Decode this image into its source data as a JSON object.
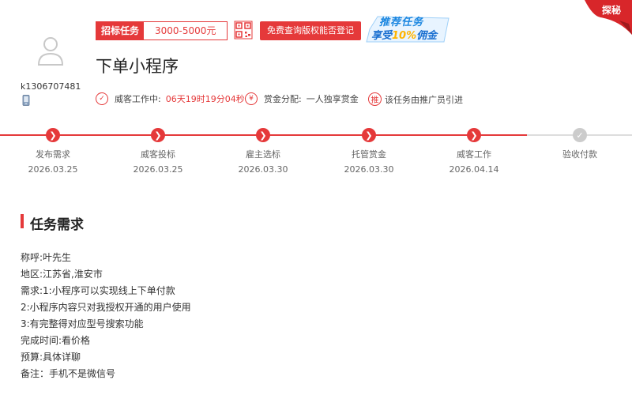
{
  "user": {
    "name": "k1306707481"
  },
  "banner": {
    "bid_tag": "招标任务",
    "bid_price": "3000-5000元",
    "check_button": "免费查询版权能否登记",
    "promo_line1": "推荐任务",
    "promo_line2_pre": "享受",
    "promo_line2_em": "10%",
    "promo_line2_post": "佣金",
    "corner_badge": "探秘"
  },
  "task": {
    "title": "下单小程序"
  },
  "meta": {
    "working_label": "威客工作中:",
    "working_time": "06天19时19分04秒",
    "reward_label": "赏金分配:",
    "reward_value": "一人独享赏金",
    "referral_badge": "推",
    "referral_text": "该任务由推广员引进"
  },
  "steps": [
    {
      "label": "发布需求",
      "date": "2026.03.25",
      "done": true
    },
    {
      "label": "威客投标",
      "date": "2026.03.25",
      "done": true
    },
    {
      "label": "雇主选标",
      "date": "2026.03.30",
      "done": true
    },
    {
      "label": "托管赏金",
      "date": "2026.03.30",
      "done": true
    },
    {
      "label": "威客工作",
      "date": "2026.04.14",
      "done": true
    },
    {
      "label": "验收付款",
      "date": "",
      "done": false
    }
  ],
  "requirements": {
    "title": "任务需求",
    "lines": [
      "称呼:叶先生",
      "地区:江苏省,淮安市",
      "需求:1:小程序可以实现线上下单付款",
      "2:小程序内容只对我授权开通的用户使用",
      "3:有完整得对应型号搜索功能",
      "完成时间:看价格",
      "预算:具体详聊",
      "备注：手机不是微信号"
    ]
  },
  "colors": {
    "accent": "#e5393a",
    "promo_blue": "#1a86e0",
    "promo_gold": "#ffb400"
  }
}
